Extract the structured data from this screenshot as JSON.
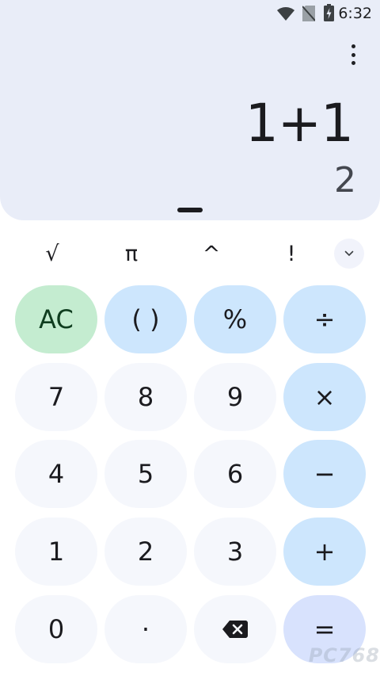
{
  "status_bar": {
    "time": "6:32",
    "icons": [
      "wifi-icon",
      "no-sim-icon",
      "battery-charging-icon"
    ]
  },
  "display": {
    "expression": "1+1",
    "result": "2"
  },
  "scientific_row": {
    "keys": [
      "√",
      "π",
      "^",
      "!"
    ],
    "expand_icon": "chevron-down-icon"
  },
  "keypad": {
    "clear": "AC",
    "parentheses": "( )",
    "percent": "%",
    "divide": "÷",
    "seven": "7",
    "eight": "8",
    "nine": "9",
    "multiply": "×",
    "four": "4",
    "five": "5",
    "six": "6",
    "subtract": "−",
    "one": "1",
    "two": "2",
    "three": "3",
    "add": "+",
    "zero": "0",
    "decimal": "·",
    "backspace_icon": "backspace-icon",
    "equals": "="
  },
  "colors": {
    "display_bg": "#e9edf8",
    "number_key": "#f5f7fc",
    "operator_key": "#cde6fd",
    "clear_key": "#c4ecd0",
    "equals_key": "#d8e2fd"
  },
  "watermark": "PC768"
}
